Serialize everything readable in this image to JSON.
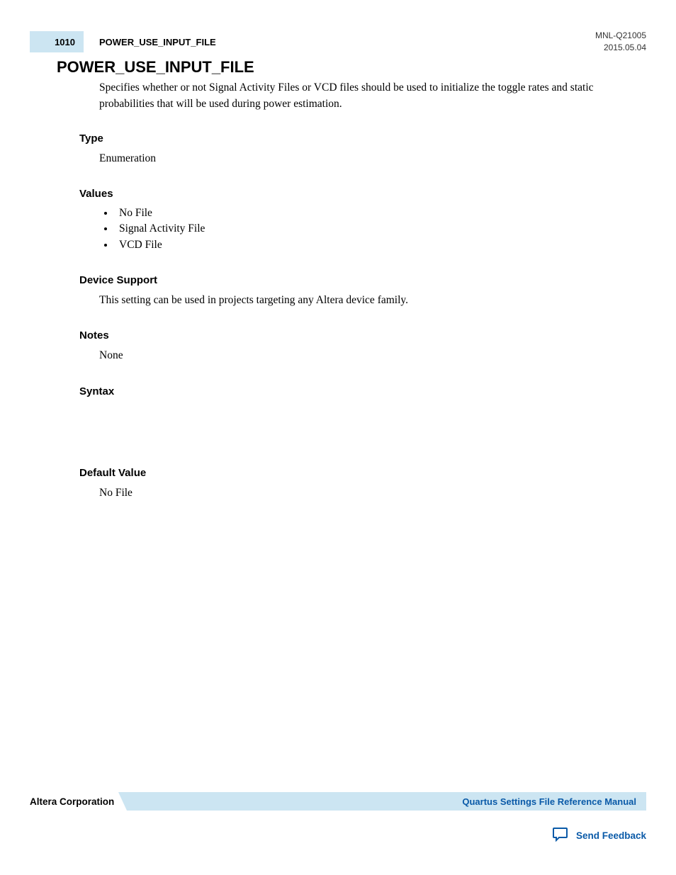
{
  "header": {
    "page_number": "1010",
    "title": "POWER_USE_INPUT_FILE",
    "doc_id": "MNL-Q21005",
    "doc_date": "2015.05.04"
  },
  "main_title": "POWER_USE_INPUT_FILE",
  "description": "Specifies whether or not Signal Activity Files or VCD files should be used to initialize the toggle rates and static probabilities that will be used during power estimation.",
  "sections": {
    "type": {
      "heading": "Type",
      "body": "Enumeration"
    },
    "values": {
      "heading": "Values",
      "items": [
        "No File",
        "Signal Activity File",
        "VCD File"
      ]
    },
    "device_support": {
      "heading": "Device Support",
      "body": "This setting can be used in projects targeting any Altera device family."
    },
    "notes": {
      "heading": "Notes",
      "body": "None"
    },
    "syntax": {
      "heading": "Syntax"
    },
    "default_value": {
      "heading": "Default Value",
      "body": "No File"
    }
  },
  "footer": {
    "corporation": "Altera Corporation",
    "manual_link": "Quartus Settings File Reference Manual",
    "feedback": "Send Feedback"
  }
}
